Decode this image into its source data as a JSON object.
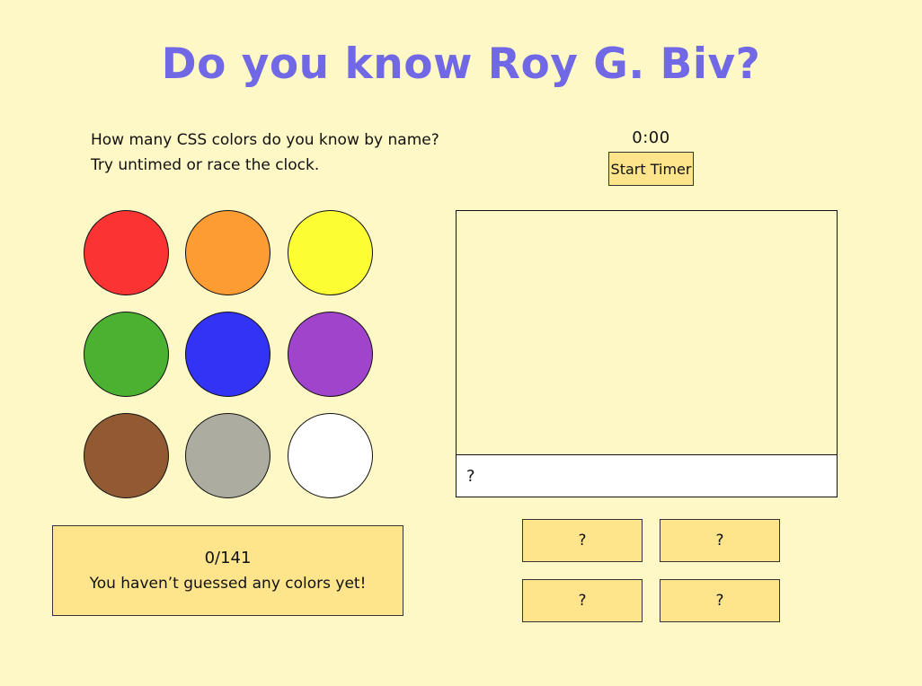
{
  "page": {
    "title": "Do you know Roy G. Biv?",
    "intro_line1": "How many CSS colors do you know by name?",
    "intro_line2": "Try untimed or race the clock."
  },
  "timer": {
    "display": "0:00",
    "button_label": "Start Timer"
  },
  "swatches": [
    {
      "name": "red",
      "color": "#fc3333"
    },
    {
      "name": "orange",
      "color": "#fd9c33"
    },
    {
      "name": "yellow",
      "color": "#fdfd33"
    },
    {
      "name": "green",
      "color": "#4bb130"
    },
    {
      "name": "blue",
      "color": "#3333f5"
    },
    {
      "name": "purple",
      "color": "#a044cc"
    },
    {
      "name": "brown",
      "color": "#915a33"
    },
    {
      "name": "gray",
      "color": "#acaca0"
    },
    {
      "name": "white",
      "color": "#ffffff"
    }
  ],
  "score": {
    "count": "0/141",
    "message": "You haven’t guessed any colors yet!"
  },
  "guess": {
    "placeholder": "?"
  },
  "choices": [
    {
      "label": "?"
    },
    {
      "label": "?"
    },
    {
      "label": "?"
    },
    {
      "label": "?"
    }
  ],
  "colors": {
    "background": "#fef8c6",
    "accent": "#7068e4",
    "panel": "#fee58c"
  }
}
